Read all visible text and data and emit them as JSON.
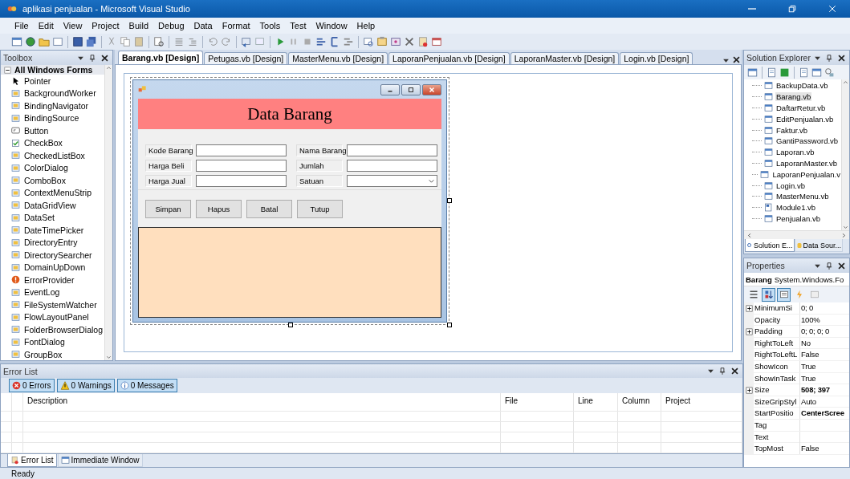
{
  "window": {
    "title": "aplikasi penjualan - Microsoft Visual Studio"
  },
  "menu": [
    "File",
    "Edit",
    "View",
    "Project",
    "Build",
    "Debug",
    "Data",
    "Format",
    "Tools",
    "Test",
    "Window",
    "Help"
  ],
  "toolbox": {
    "title": "Toolbox",
    "group": {
      "label": "All Windows Forms",
      "expanded": true
    },
    "items": [
      {
        "label": "Pointer",
        "kind": "pointer"
      },
      {
        "label": "BackgroundWorker",
        "kind": "component"
      },
      {
        "label": "BindingNavigator",
        "kind": "component"
      },
      {
        "label": "BindingSource",
        "kind": "component"
      },
      {
        "label": "Button",
        "kind": "button"
      },
      {
        "label": "CheckBox",
        "kind": "check"
      },
      {
        "label": "CheckedListBox",
        "kind": "component"
      },
      {
        "label": "ColorDialog",
        "kind": "component"
      },
      {
        "label": "ComboBox",
        "kind": "component"
      },
      {
        "label": "ContextMenuStrip",
        "kind": "component"
      },
      {
        "label": "DataGridView",
        "kind": "component"
      },
      {
        "label": "DataSet",
        "kind": "component"
      },
      {
        "label": "DateTimePicker",
        "kind": "component"
      },
      {
        "label": "DirectoryEntry",
        "kind": "component"
      },
      {
        "label": "DirectorySearcher",
        "kind": "component"
      },
      {
        "label": "DomainUpDown",
        "kind": "component"
      },
      {
        "label": "ErrorProvider",
        "kind": "error"
      },
      {
        "label": "EventLog",
        "kind": "component"
      },
      {
        "label": "FileSystemWatcher",
        "kind": "component"
      },
      {
        "label": "FlowLayoutPanel",
        "kind": "component"
      },
      {
        "label": "FolderBrowserDialog",
        "kind": "component"
      },
      {
        "label": "FontDialog",
        "kind": "component"
      },
      {
        "label": "GroupBox",
        "kind": "component"
      }
    ]
  },
  "editor": {
    "tabs": [
      {
        "label": "Barang.vb [Design]",
        "selected": true
      },
      {
        "label": "Petugas.vb [Design]",
        "selected": false
      },
      {
        "label": "MasterMenu.vb [Design]",
        "selected": false
      },
      {
        "label": "LaporanPenjualan.vb [Design]",
        "selected": false
      },
      {
        "label": "LaporanMaster.vb [Design]",
        "selected": false
      },
      {
        "label": "Login.vb [Design]",
        "selected": false
      }
    ],
    "form": {
      "heading": "Data Barang",
      "left_fields": [
        {
          "label": "Kode Barang",
          "kind": "text"
        },
        {
          "label": "Harga Beli",
          "kind": "text"
        },
        {
          "label": "Harga Jual",
          "kind": "text"
        }
      ],
      "right_fields": [
        {
          "label": "Nama Barang",
          "kind": "text"
        },
        {
          "label": "Jumlah",
          "kind": "text"
        },
        {
          "label": "Satuan",
          "kind": "combo"
        }
      ],
      "buttons": [
        "Simpan",
        "Hapus",
        "Batal",
        "Tutup"
      ]
    }
  },
  "solution_explorer": {
    "title": "Solution Explorer",
    "items": [
      {
        "label": "BackupData.vb",
        "kind": "form",
        "selected": false
      },
      {
        "label": "Barang.vb",
        "kind": "form",
        "selected": true
      },
      {
        "label": "DaftarRetur.vb",
        "kind": "form",
        "selected": false
      },
      {
        "label": "EditPenjualan.vb",
        "kind": "form",
        "selected": false
      },
      {
        "label": "Faktur.vb",
        "kind": "form",
        "selected": false
      },
      {
        "label": "GantiPassword.vb",
        "kind": "form",
        "selected": false
      },
      {
        "label": "Laporan.vb",
        "kind": "form",
        "selected": false
      },
      {
        "label": "LaporanMaster.vb",
        "kind": "form",
        "selected": false
      },
      {
        "label": "LaporanPenjualan.v",
        "kind": "form",
        "selected": false
      },
      {
        "label": "Login.vb",
        "kind": "form",
        "selected": false
      },
      {
        "label": "MasterMenu.vb",
        "kind": "form",
        "selected": false
      },
      {
        "label": "Module1.vb",
        "kind": "module",
        "selected": false
      },
      {
        "label": "Penjualan.vb",
        "kind": "form",
        "selected": false
      }
    ],
    "tabs": [
      {
        "label": "Solution E...",
        "selected": true
      },
      {
        "label": "Data Sour...",
        "selected": false
      }
    ]
  },
  "properties": {
    "title": "Properties",
    "object": "Barang",
    "object_type": "System.Windows.Fo",
    "rows": [
      {
        "name": "MinimumSi",
        "value": "0; 0",
        "expandable": true,
        "modified": false
      },
      {
        "name": "Opacity",
        "value": "100%",
        "expandable": false,
        "modified": false
      },
      {
        "name": "Padding",
        "value": "0; 0; 0; 0",
        "expandable": true,
        "modified": false
      },
      {
        "name": "RightToLeft",
        "value": "No",
        "expandable": false,
        "modified": false
      },
      {
        "name": "RightToLeftL",
        "value": "False",
        "expandable": false,
        "modified": false
      },
      {
        "name": "ShowIcon",
        "value": "True",
        "expandable": false,
        "modified": false
      },
      {
        "name": "ShowInTask",
        "value": "True",
        "expandable": false,
        "modified": false
      },
      {
        "name": "Size",
        "value": "508; 397",
        "expandable": true,
        "modified": true
      },
      {
        "name": "SizeGripStyl",
        "value": "Auto",
        "expandable": false,
        "modified": false
      },
      {
        "name": "StartPositio",
        "value": "CenterScree",
        "expandable": false,
        "modified": true
      },
      {
        "name": "Tag",
        "expandable": false
      },
      {
        "name": "Text",
        "expandable": false
      },
      {
        "name": "TopMost",
        "value": "False",
        "expandable": false,
        "modified": false
      }
    ]
  },
  "error_list": {
    "title": "Error List",
    "filters": [
      {
        "label": "0 Errors",
        "kind": "error",
        "selected": true
      },
      {
        "label": "0 Warnings",
        "kind": "warning",
        "selected": true
      },
      {
        "label": "0 Messages",
        "kind": "info",
        "selected": true
      }
    ],
    "columns": [
      "Description",
      "File",
      "Line",
      "Column",
      "Project"
    ],
    "tabs": [
      {
        "label": "Error List",
        "selected": true
      },
      {
        "label": "Immediate Window",
        "selected": false
      }
    ]
  },
  "status_bar": "Ready"
}
